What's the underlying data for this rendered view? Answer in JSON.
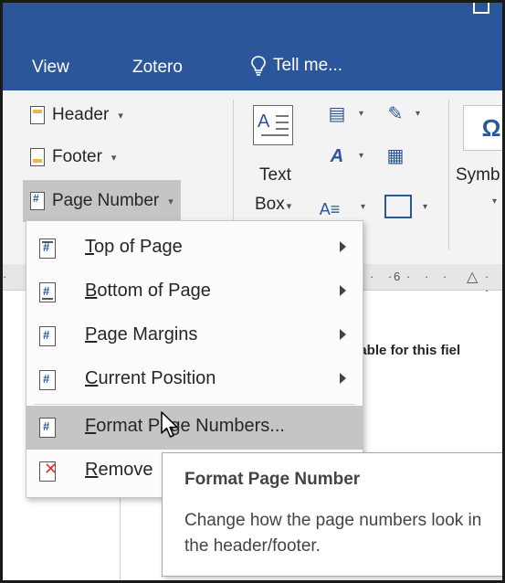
{
  "tabs": [
    {
      "label": "View"
    },
    {
      "label": "Zotero"
    }
  ],
  "tell_me": {
    "label": "Tell me..."
  },
  "ribbon": {
    "header": {
      "label": "Header"
    },
    "footer": {
      "label": "Footer"
    },
    "page_number": {
      "label": "Page Number"
    },
    "text_box": {
      "line1": "Text",
      "line2": "Box"
    },
    "symbol": {
      "label": "Symb"
    },
    "symbol_icon": "Ω"
  },
  "ruler": {
    "mark": "6"
  },
  "document": {
    "partial_text": "ilable for this fiel"
  },
  "menu": {
    "items": [
      {
        "accel": "T",
        "rest": "op of Page",
        "has_submenu": true,
        "icon": "page-top-icon"
      },
      {
        "accel": "B",
        "rest": "ottom of Page",
        "has_submenu": true,
        "icon": "page-bottom-icon"
      },
      {
        "accel": "P",
        "rest": "age Margins",
        "has_submenu": true,
        "icon": "page-margins-icon"
      },
      {
        "accel": "C",
        "rest": "urrent Position",
        "has_submenu": true,
        "icon": "current-position-icon"
      },
      {
        "accel": "F",
        "rest": "ormat Page Numbers...",
        "has_submenu": false,
        "icon": "format-page-numbers-icon"
      },
      {
        "accel": "R",
        "rest": "emove",
        "has_submenu": false,
        "icon": "remove-page-numbers-icon"
      }
    ]
  },
  "tooltip": {
    "title": "Format Page Number",
    "body": "Change how the page numbers look in the header/footer."
  },
  "colors": {
    "accent": "#2b579a",
    "ribbon_bg": "#f3f3f3",
    "hover": "#c5c5c5",
    "remove_red": "#d9352b"
  }
}
